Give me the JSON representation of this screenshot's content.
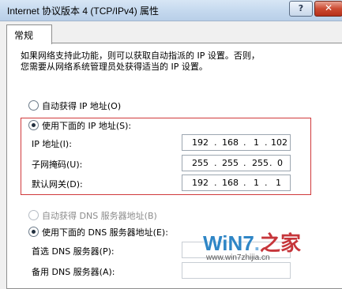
{
  "window": {
    "title": "Internet 协议版本 4 (TCP/IPv4) 属性",
    "help_label": "?",
    "close_label": "✕"
  },
  "tabs": [
    {
      "label": "常规"
    }
  ],
  "description": {
    "line1": "如果网络支持此功能，则可以获取自动指派的 IP 设置。否则，",
    "line2": "您需要从网络系统管理员处获得适当的 IP 设置。"
  },
  "ip_mode": {
    "auto_label": "自动获得 IP 地址(O)",
    "manual_label": "使用下面的 IP 地址(S):",
    "selected": "manual"
  },
  "ip_fields": [
    {
      "label": "IP 地址(I):",
      "octets": [
        "192",
        "168",
        "1",
        "102"
      ]
    },
    {
      "label": "子网掩码(U):",
      "octets": [
        "255",
        "255",
        "255",
        "0"
      ]
    },
    {
      "label": "默认网关(D):",
      "octets": [
        "192",
        "168",
        "1",
        "1"
      ]
    }
  ],
  "dns_mode": {
    "auto_label": "自动获得 DNS 服务器地址(B)",
    "manual_label": "使用下面的 DNS 服务器地址(E):",
    "selected": "manual"
  },
  "dns_fields": [
    {
      "label": "首选 DNS 服务器(P):",
      "value": ""
    },
    {
      "label": "备用 DNS 服务器(A):",
      "value": ""
    }
  ],
  "watermark": {
    "brand_win": "WiN",
    "brand_num": "7",
    "brand_cn": "之家",
    "url": "www.win7zhijia.cn"
  },
  "colors": {
    "highlight_frame": "#d0393b",
    "titlebar": "#c4d8ee"
  }
}
